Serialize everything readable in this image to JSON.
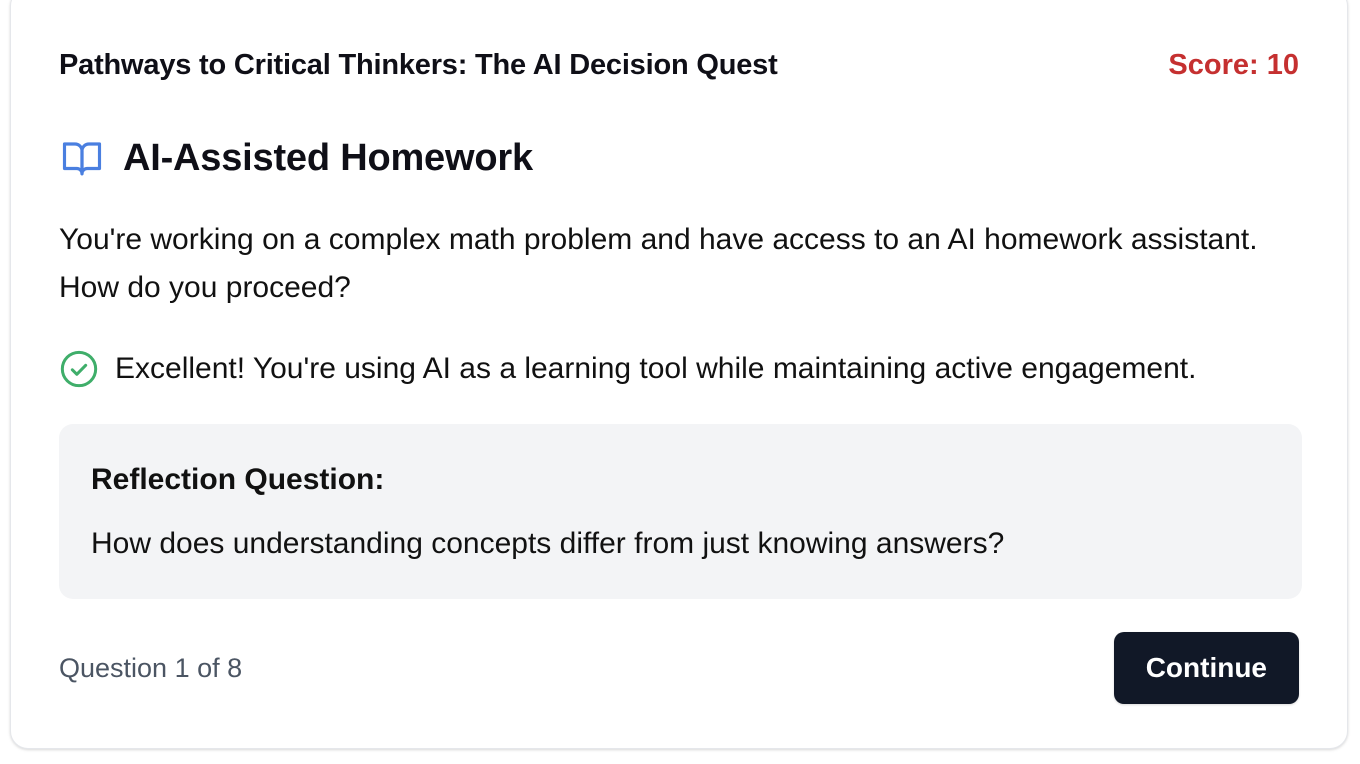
{
  "app": {
    "title": "Pathways to Critical Thinkers: The AI Decision Quest",
    "score_text": "Score: 10"
  },
  "scenario": {
    "icon": "book-open-icon",
    "title": "AI-Assisted Homework",
    "prompt": "You're working on a complex math problem and have access to an AI homework assistant. How do you proceed?"
  },
  "feedback": {
    "icon": "check-circle-icon",
    "text": "Excellent! You're using AI as a learning tool while maintaining active engagement."
  },
  "reflection": {
    "heading": "Reflection Question:",
    "question": "How does understanding concepts differ from just knowing answers?"
  },
  "footer": {
    "progress_text": "Question 1 of 8",
    "continue_label": "Continue"
  },
  "colors": {
    "score": "#c53030",
    "icon_blue": "#4a7fe0",
    "success_green": "#3fae6a",
    "button_bg": "#111827",
    "panel_bg": "#f3f4f6"
  }
}
